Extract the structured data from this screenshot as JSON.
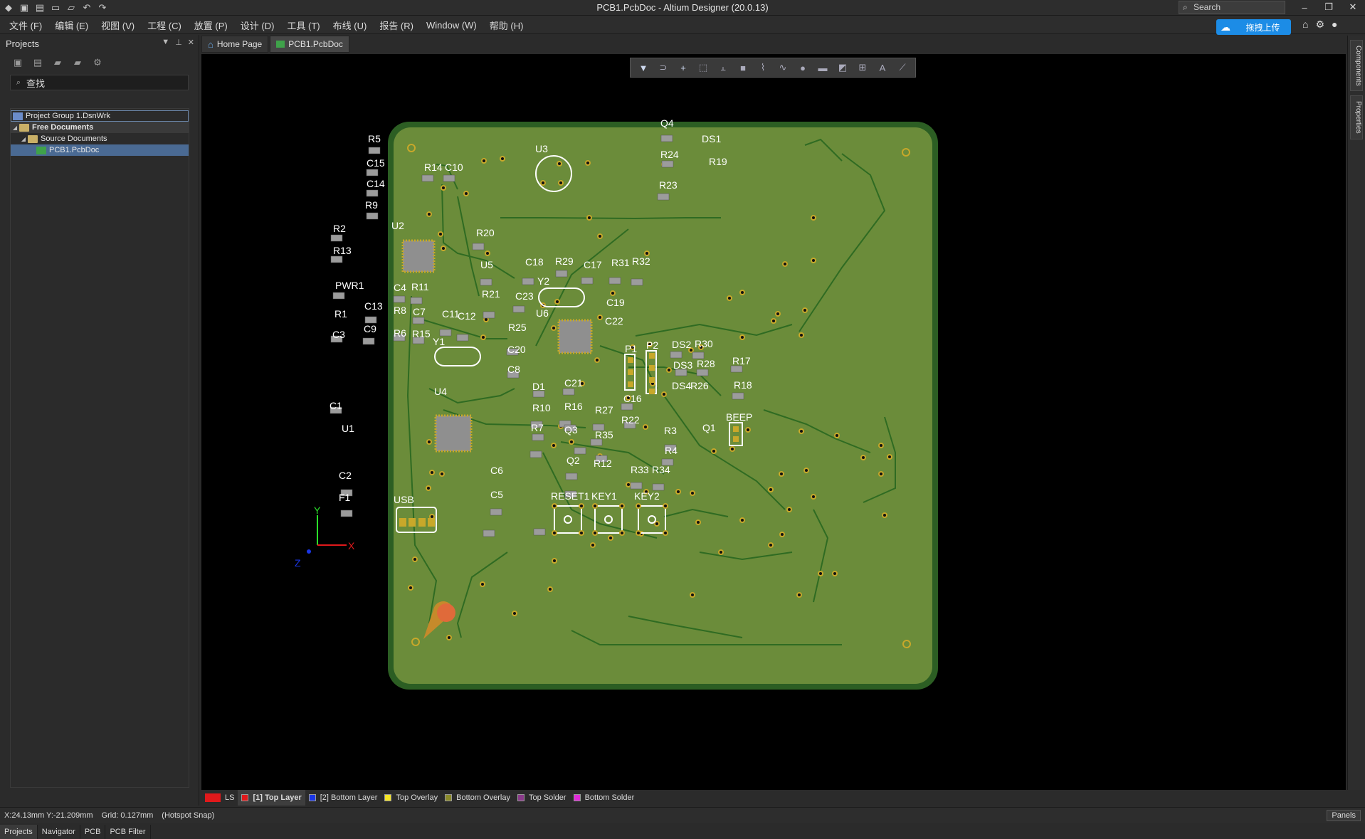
{
  "window": {
    "title": "PCB1.PcbDoc - Altium Designer (20.0.13)",
    "search_placeholder": "Search"
  },
  "menu": {
    "items": [
      "文件 (F)",
      "编辑 (E)",
      "视图 (V)",
      "工程 (C)",
      "放置 (P)",
      "设计 (D)",
      "工具 (T)",
      "布线 (U)",
      "报告 (R)",
      "Window (W)",
      "帮助 (H)"
    ],
    "upload_label": "拖拽上传"
  },
  "projects_panel": {
    "title": "Projects",
    "search_placeholder": "查找",
    "tree": [
      {
        "label": "Project Group 1.DsnWrk"
      },
      {
        "label": "Free Documents"
      },
      {
        "label": "Source Documents"
      },
      {
        "label": "PCB1.PcbDoc"
      }
    ],
    "bottom_tabs": [
      "Projects",
      "Navigator",
      "PCB",
      "PCB Filter"
    ]
  },
  "doc_tabs": [
    {
      "label": "Home Page"
    },
    {
      "label": "PCB1.PcbDoc"
    }
  ],
  "right_rail": {
    "tabs": [
      "Components",
      "Properties"
    ]
  },
  "pcb": {
    "board_color": "#6b8c3a",
    "edge_color": "#2c5e23",
    "silk_color": "#ffffff",
    "pad_color": "#c8a82a",
    "designators": [
      "R5",
      "C15",
      "C14",
      "R9",
      "R14",
      "C10",
      "U3",
      "Q4",
      "DS1",
      "R24",
      "R19",
      "R23",
      "R2",
      "U2",
      "R13",
      "R20",
      "U5",
      "C18",
      "R29",
      "C17",
      "R31",
      "R32",
      "PWR1",
      "C4",
      "R11",
      "Y2",
      "R21",
      "C23",
      "C13",
      "R8",
      "C7",
      "C11",
      "C12",
      "U6",
      "C19",
      "R1",
      "C9",
      "R6",
      "R15",
      "C22",
      "R25",
      "C3",
      "Y1",
      "C20",
      "P1",
      "P2",
      "DS2",
      "R30",
      "C8",
      "DS3",
      "R28",
      "R17",
      "U4",
      "D1",
      "C21",
      "DS4",
      "R26",
      "R18",
      "C16",
      "R10",
      "R16",
      "R27",
      "BEEP",
      "C1",
      "R22",
      "U1",
      "R7",
      "Q3",
      "R35",
      "R3",
      "Q1",
      "R4",
      "Q2",
      "R12",
      "C2",
      "R33",
      "R34",
      "C6",
      "F1",
      "USB",
      "C5",
      "RESET1",
      "KEY1",
      "KEY2"
    ],
    "axis_y": "Y",
    "axis_x": "X",
    "axis_z": "Z"
  },
  "layers": {
    "ls": "LS",
    "items": [
      {
        "label": "[1] Top Layer",
        "color": "#e0191b"
      },
      {
        "label": "[2] Bottom Layer",
        "color": "#1a36e6"
      },
      {
        "label": "Top Overlay",
        "color": "#f5e526"
      },
      {
        "label": "Bottom Overlay",
        "color": "#8a8a2a"
      },
      {
        "label": "Top Solder",
        "color": "#8a3a8a"
      },
      {
        "label": "Bottom Solder",
        "color": "#e02ad8"
      }
    ]
  },
  "status": {
    "coords": "X:24.13mm Y:-21.209mm",
    "grid": "Grid: 0.127mm",
    "snap": "(Hotspot Snap)",
    "panels": "Panels"
  }
}
